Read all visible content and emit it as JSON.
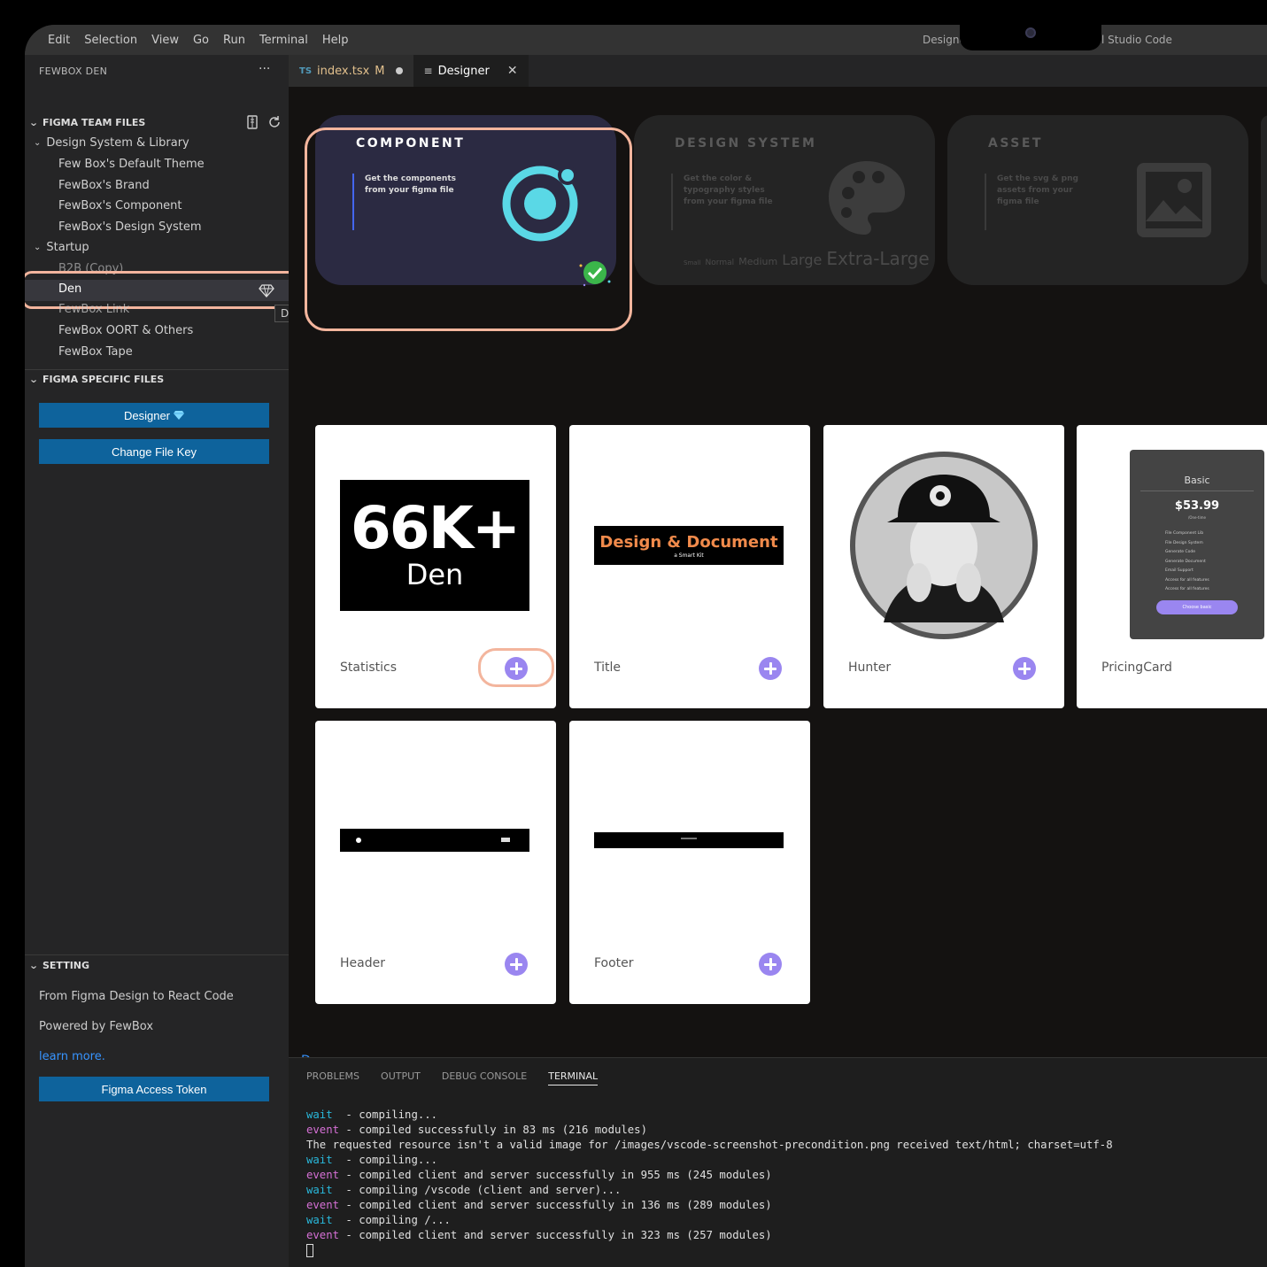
{
  "menu": [
    "Edit",
    "Selection",
    "View",
    "Go",
    "Run",
    "Terminal",
    "Help"
  ],
  "window_title_left": "Designe",
  "window_title_right": "l Studio Code",
  "sidebar": {
    "header": "FEWBOX DEN",
    "more": "···",
    "team_section": "FIGMA TEAM FILES",
    "design_folder": "Design System & Library",
    "design_items": [
      "Few Box's Default Theme",
      "FewBox's Brand",
      "FewBox's Component",
      "FewBox's Design System"
    ],
    "startup_folder": "Startup",
    "startup_items": [
      "B2B (Copy)",
      "Den",
      "FewBox Link",
      "FewBox OORT & Others",
      "FewBox Tape"
    ],
    "tooltip": "Den",
    "specific_section": "FIGMA SPECIFIC FILES",
    "designer_button": "Designer",
    "change_key_button": "Change File Key",
    "setting_section": "SETTING",
    "setting_line1": "From Figma Design to React Code",
    "setting_line2": "Powered by FewBox",
    "learn_more": "learn more.",
    "token_button": "Figma Access Token"
  },
  "tabs": {
    "ts_badge": "TS",
    "ts_file": "index.tsx",
    "ts_mod": "M",
    "designer": "Designer",
    "close": "✕"
  },
  "modes": [
    {
      "title": "COMPONENT",
      "desc": "Get the components from your figma file"
    },
    {
      "title": "DESIGN SYSTEM",
      "desc": "Get the color & typography styles from your figma file",
      "sizes": [
        "Small",
        "Normal",
        "Medium",
        "Large",
        "Extra-Large"
      ]
    },
    {
      "title": "ASSET",
      "desc": "Get the svg & png assets from your figma file"
    }
  ],
  "components": [
    {
      "name": "Statistics",
      "big": "66K+",
      "sub": "Den"
    },
    {
      "name": "Title",
      "big": "Design & Document",
      "sub": "a Smart Kit"
    },
    {
      "name": "Hunter"
    },
    {
      "name": "PricingCard",
      "plan": "Basic",
      "price": "$53.99",
      "period": "/One-time",
      "features": [
        "File Component Lib",
        "File Design System",
        "Generate Code",
        "Generate Document",
        "Email Support",
        "Access for all features",
        "Access for all features"
      ],
      "cta": "Choose basic"
    },
    {
      "name": "Header"
    },
    {
      "name": "Footer"
    }
  ],
  "editor_footer": "Den",
  "panel": {
    "tabs": [
      "PROBLEMS",
      "OUTPUT",
      "DEBUG CONSOLE",
      "TERMINAL"
    ],
    "lines": [
      {
        "k": "wait",
        "t": "  - compiling..."
      },
      {
        "k": "event",
        "t": " - compiled successfully in 83 ms (216 modules)"
      },
      {
        "k": "",
        "t": "The requested resource isn't a valid image for /images/vscode-screenshot-precondition.png received text/html; charset=utf-8"
      },
      {
        "k": "wait",
        "t": "  - compiling..."
      },
      {
        "k": "event",
        "t": " - compiled client and server successfully in 955 ms (245 modules)"
      },
      {
        "k": "wait",
        "t": "  - compiling /vscode (client and server)..."
      },
      {
        "k": "event",
        "t": " - compiled client and server successfully in 136 ms (289 modules)"
      },
      {
        "k": "wait",
        "t": "  - compiling /..."
      },
      {
        "k": "event",
        "t": " - compiled client and server successfully in 323 ms (257 modules)"
      }
    ]
  },
  "colors": {
    "accent": "#0e639c",
    "highlight": "#f3b59d",
    "plus": "#9a86f0",
    "ionic": "#5ad8e6"
  }
}
